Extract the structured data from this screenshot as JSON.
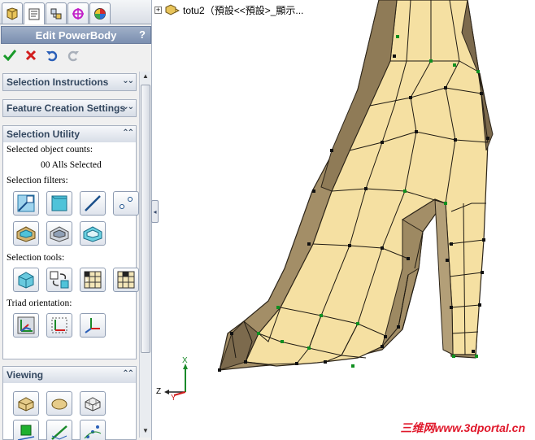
{
  "property_manager": {
    "title": "Edit PowerBody",
    "help": "?",
    "tabs": [
      "feature-manager",
      "property-manager",
      "configuration-manager",
      "dimxpert-manager",
      "display-manager"
    ],
    "groups": {
      "selection_instructions": "Selection Instructions",
      "feature_creation": "Feature Creation Settings",
      "selection_utility": {
        "title": "Selection Utility",
        "counts_label": "Selected object counts:",
        "counts_value": "00 Alls Selected",
        "filters_label": "Selection filters:",
        "tools_label": "Selection tools:",
        "triad_label": "Triad orientation:"
      },
      "viewing": "Viewing"
    }
  },
  "tree": {
    "expander": "+",
    "item": "totu2（預設<<預設>_顯示..."
  },
  "triad": {
    "x": "Z",
    "y": "X",
    "z": "Y"
  },
  "watermark": "三维网www.3dportal.cn",
  "colors": {
    "accent": "#7b8fb0",
    "mesh_face": "#f7e4a6",
    "mesh_shadow": "#8e7c5c",
    "vertex": "#0f8f1f",
    "watermark": "#e0182b"
  }
}
